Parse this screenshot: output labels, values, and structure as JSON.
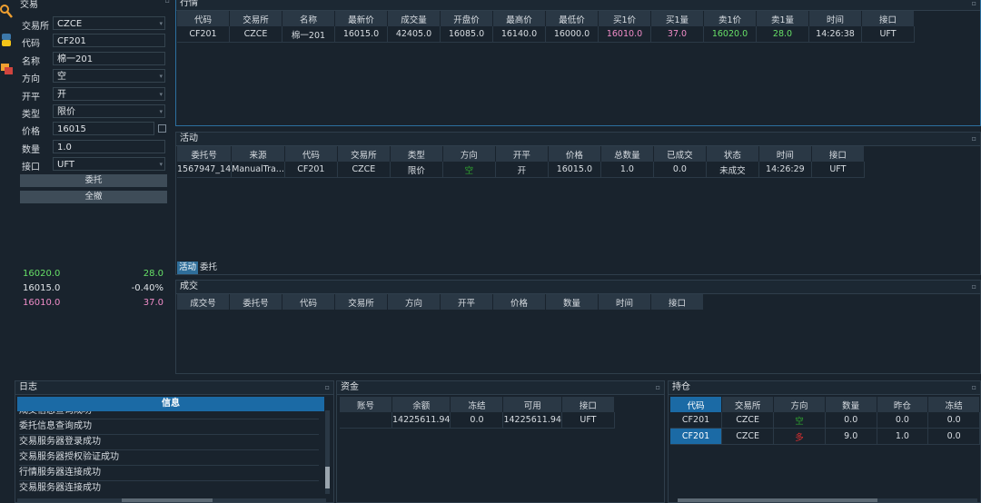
{
  "colors": {
    "accent": "#1b6aa5",
    "bg": "#19232d",
    "header": "#2a3845",
    "up": "#f08cc8",
    "down": "#67e067"
  },
  "left_icons": [
    "search-icon",
    "python-icon",
    "chat-icon"
  ],
  "trade_panel": {
    "title": "交易",
    "fields": [
      {
        "label": "交易所",
        "value": "CZCE",
        "dropdown": true
      },
      {
        "label": "代码",
        "value": "CF201",
        "dropdown": false
      },
      {
        "label": "名称",
        "value": "棉一201",
        "dropdown": false
      },
      {
        "label": "方向",
        "value": "空",
        "dropdown": true
      },
      {
        "label": "开平",
        "value": "开",
        "dropdown": true
      },
      {
        "label": "类型",
        "value": "限价",
        "dropdown": true
      },
      {
        "label": "价格",
        "value": "16015",
        "dropdown": false
      },
      {
        "label": "数量",
        "value": "1.0",
        "dropdown": false
      },
      {
        "label": "接口",
        "value": "UFT",
        "dropdown": true
      }
    ],
    "submit_label": "委托",
    "cancel_all_label": "全撤",
    "depth": [
      {
        "price": "16020.0",
        "value": "28.0",
        "color": "green"
      },
      {
        "price": "16015.0",
        "value": "-0.40%",
        "color": "white"
      },
      {
        "price": "16010.0",
        "value": "37.0",
        "color": "red"
      }
    ]
  },
  "market_panel": {
    "title": "行情",
    "columns": [
      "代码",
      "交易所",
      "名称",
      "最新价",
      "成交量",
      "开盘价",
      "最高价",
      "最低价",
      "买1价",
      "买1量",
      "卖1价",
      "卖1量",
      "时间",
      "接口"
    ],
    "rows": [
      [
        "CF201",
        "CZCE",
        "棉一201",
        "16015.0",
        "42405.0",
        "16085.0",
        "16140.0",
        "16000.0",
        "16010.0",
        "37.0",
        "16020.0",
        "28.0",
        "14:26:38",
        "UFT"
      ]
    ]
  },
  "active_panel": {
    "title": "活动",
    "columns": [
      "委托号",
      "来源",
      "代码",
      "交易所",
      "类型",
      "方向",
      "开平",
      "价格",
      "总数量",
      "已成交",
      "状态",
      "时间",
      "接口"
    ],
    "rows": [
      [
        "1567947_14",
        "ManualTra...",
        "CF201",
        "CZCE",
        "限价",
        "空",
        "开",
        "16015.0",
        "1.0",
        "0.0",
        "未成交",
        "14:26:29",
        "UFT"
      ]
    ],
    "tabs": [
      "活动",
      "委托"
    ]
  },
  "trades_panel": {
    "title": "成交",
    "columns": [
      "成交号",
      "委托号",
      "代码",
      "交易所",
      "方向",
      "开平",
      "价格",
      "数量",
      "时间",
      "接口"
    ]
  },
  "log_panel": {
    "title": "日志",
    "column": "信息",
    "lines": [
      "成交信息查询成功",
      "委托信息查询成功",
      "交易服务器登录成功",
      "交易服务器授权验证成功",
      "行情服务器连接成功",
      "交易服务器连接成功"
    ]
  },
  "account_panel": {
    "title": "资金",
    "columns": [
      "账号",
      "余额",
      "冻结",
      "可用",
      "接口"
    ],
    "rows": [
      [
        "",
        "14225611.94",
        "0.0",
        "14225611.94",
        "UFT"
      ]
    ]
  },
  "position_panel": {
    "title": "持仓",
    "columns": [
      "代码",
      "交易所",
      "方向",
      "数量",
      "昨仓",
      "冻结"
    ],
    "rows": [
      [
        "CF201",
        "CZCE",
        "空",
        "0.0",
        "0.0",
        "0.0"
      ],
      [
        "CF201",
        "CZCE",
        "多",
        "9.0",
        "1.0",
        "0.0"
      ]
    ]
  }
}
